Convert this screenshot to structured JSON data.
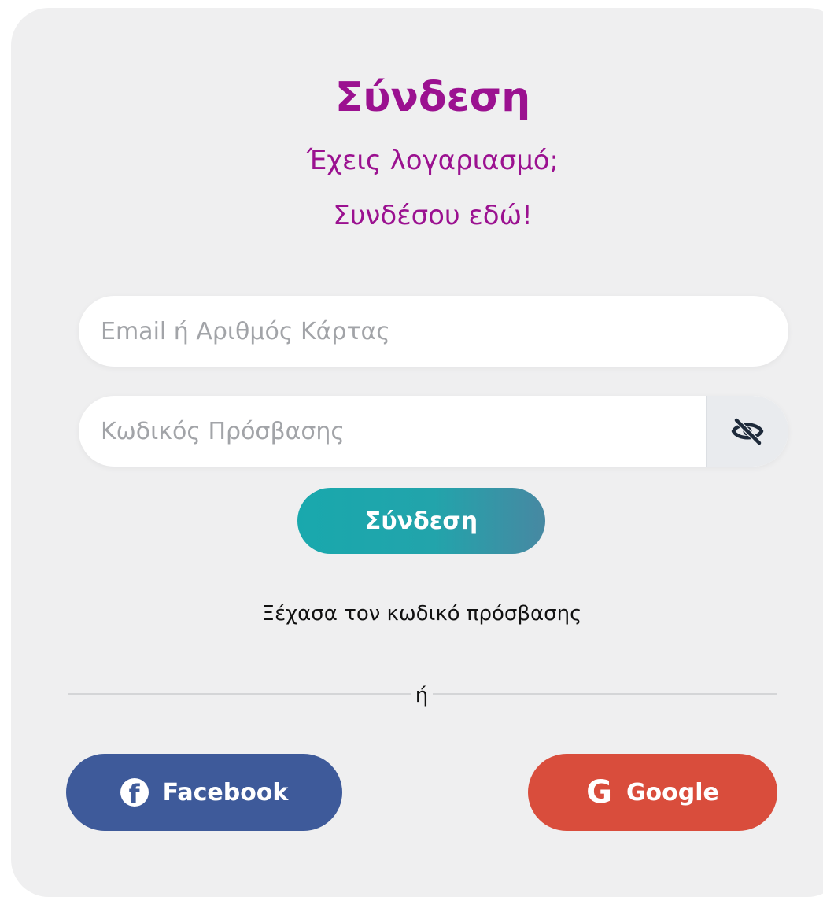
{
  "login": {
    "title": "Σύνδεση",
    "subtitle_line1": "Έχεις λογαριασμό;",
    "subtitle_line2": "Συνδέσου εδώ!",
    "email_placeholder": "Email ή Αριθμός Κάρτας",
    "password_placeholder": "Κωδικός Πρόσβασης",
    "submit_label": "Σύνδεση",
    "forgot_label": "Ξέχασα τον κωδικό πρόσβασης",
    "divider_label": "ή"
  },
  "social": {
    "facebook_label": "Facebook",
    "facebook_icon": "facebook-icon",
    "google_label": "Google",
    "google_icon": "google-icon"
  },
  "colors": {
    "title": "#9b1190",
    "card_background": "#efeff0",
    "login_button_gradient": [
      "#19a8ad",
      "#4788a2"
    ],
    "facebook": "#3e5a9a",
    "google": "#d94d3c"
  }
}
